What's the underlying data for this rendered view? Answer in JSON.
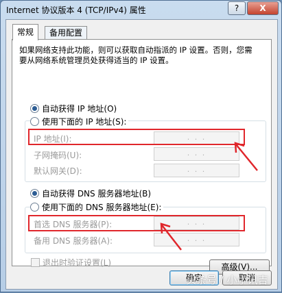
{
  "window": {
    "title": "Internet 协议版本 4 (TCP/IPv4) 属性",
    "help_label": "?",
    "close_label": "X"
  },
  "tabs": [
    {
      "label": "常规",
      "active": true
    },
    {
      "label": "备用配置",
      "active": false
    }
  ],
  "description": "如果网络支持此功能，则可以获取自动指派的 IP 设置。否则，您需要从网络系统管理员处获得适当的 IP 设置。",
  "ip_section": {
    "auto_label": "自动获得 IP 地址(O)",
    "manual_label": "使用下面的 IP 地址(S):",
    "selected": "auto",
    "fields": [
      {
        "label": "IP 地址(I):",
        "value": ". . ."
      },
      {
        "label": "子网掩码(U):",
        "value": ". . ."
      },
      {
        "label": "默认网关(D):",
        "value": ". . ."
      }
    ]
  },
  "dns_section": {
    "auto_label": "自动获得 DNS 服务器地址(B)",
    "manual_label": "使用下面的 DNS 服务器地址(E):",
    "selected": "auto",
    "fields": [
      {
        "label": "首选 DNS 服务器(P):",
        "value": ". . ."
      },
      {
        "label": "备用 DNS 服务器(A):",
        "value": ". . ."
      }
    ]
  },
  "validate_label": "退出时验证设置(L)",
  "advanced_label": "高级(V)...",
  "ok_label": "确定",
  "cancel_label": "取消",
  "watermark": "头条号 / 小小讯吉",
  "colors": {
    "highlight": "#e0262b",
    "selected_radio": "#2d5d94"
  }
}
